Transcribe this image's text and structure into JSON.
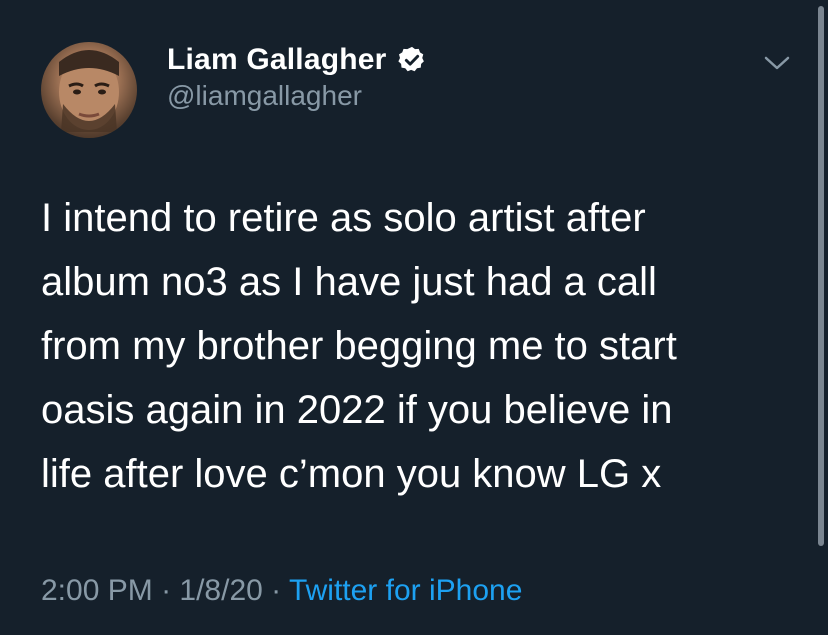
{
  "author": {
    "display_name": "Liam Gallagher",
    "handle": "@liamgallagher",
    "verified_icon": "verified-badge-icon",
    "avatar": "profile-photo"
  },
  "tweet": {
    "lines": [
      "I intend to retire as solo artist after",
      "album no3 as I have just had a call",
      "from my brother begging me to start",
      "oasis again in 2022 if you believe in",
      "life after love c’mon you know LG x"
    ],
    "time": "2:00 PM",
    "separator": " · ",
    "date": "1/8/20",
    "source": "Twitter for iPhone"
  },
  "menu": {
    "icon": "chevron-down-icon"
  },
  "colors": {
    "background": "#15202b",
    "text": "#ffffff",
    "secondary": "#8899a6",
    "link": "#1da1f2"
  }
}
